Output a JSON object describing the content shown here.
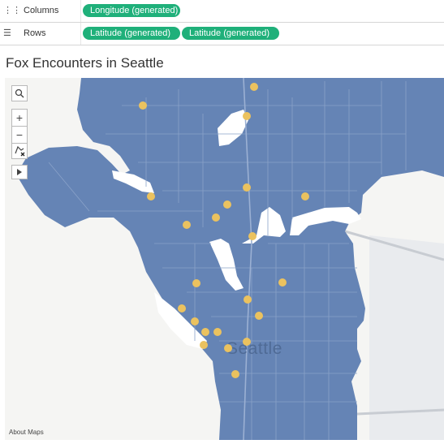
{
  "shelves": {
    "columns": {
      "label": "Columns",
      "pills": [
        "Longitude (generated)"
      ]
    },
    "rows": {
      "label": "Rows",
      "pills": [
        "Latitude (generated)",
        "Latitude (generated)"
      ]
    }
  },
  "title": "Fox Encounters in Seattle",
  "map": {
    "city_label": "Seattle",
    "attribution": "About Maps",
    "land_color": "#6584b5",
    "water_color": "#ffffff",
    "mark_color": "#ebc25f",
    "controls": [
      "search-icon",
      "zoom-in-icon",
      "zoom-out-icon",
      "pan-select-icon",
      "play-icon"
    ],
    "mark_count": 22
  }
}
